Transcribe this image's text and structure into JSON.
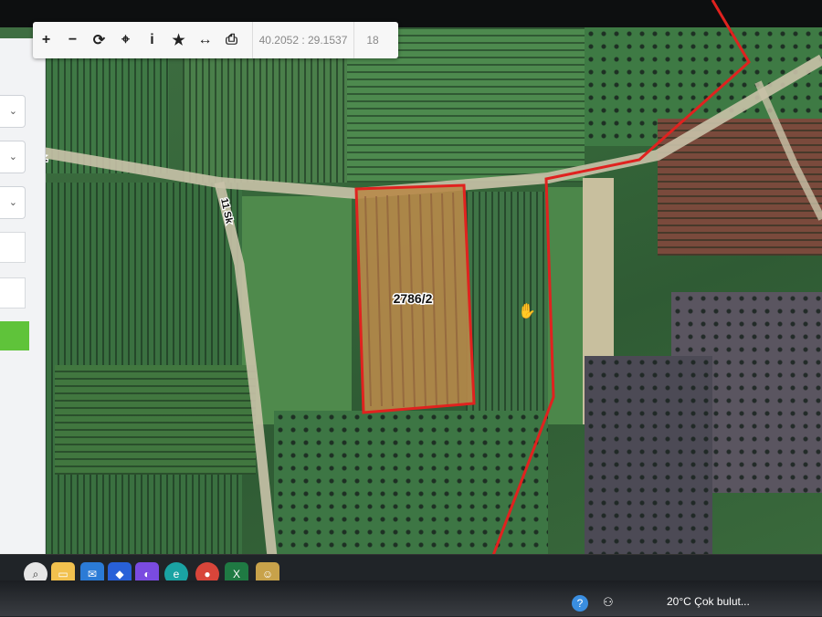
{
  "toolbar": {
    "tools": [
      {
        "icon": "plus-icon",
        "glyph": "+"
      },
      {
        "icon": "minus-icon",
        "glyph": "−"
      },
      {
        "icon": "refresh-icon",
        "glyph": "⟳"
      },
      {
        "icon": "locate-icon",
        "glyph": "⌖"
      },
      {
        "icon": "info-icon",
        "glyph": "i"
      },
      {
        "icon": "star-icon",
        "glyph": "★"
      },
      {
        "icon": "measure-icon",
        "glyph": "↔"
      },
      {
        "icon": "print-icon",
        "glyph": "⎙"
      }
    ],
    "coordinates": "40.2052 : 29.1537",
    "zoom_level": "18"
  },
  "map": {
    "parcel_label": "2786/2",
    "road_labels": {
      "left": "Sk.",
      "vertical": "11 Sk"
    },
    "colors": {
      "parcel_outline": "#e0221f",
      "boundary": "#e0221f",
      "road": "#c9c2a8"
    }
  },
  "taskbar": {
    "apps": [
      {
        "icon": "search-icon"
      },
      {
        "icon": "file-explorer-icon"
      },
      {
        "icon": "mail-icon"
      },
      {
        "icon": "dropbox-icon"
      },
      {
        "icon": "copilot-icon"
      },
      {
        "icon": "edge-icon"
      },
      {
        "icon": "chrome-icon"
      },
      {
        "icon": "excel-icon"
      },
      {
        "icon": "app-icon"
      }
    ],
    "weather": "20°C  Çok bulut..."
  }
}
